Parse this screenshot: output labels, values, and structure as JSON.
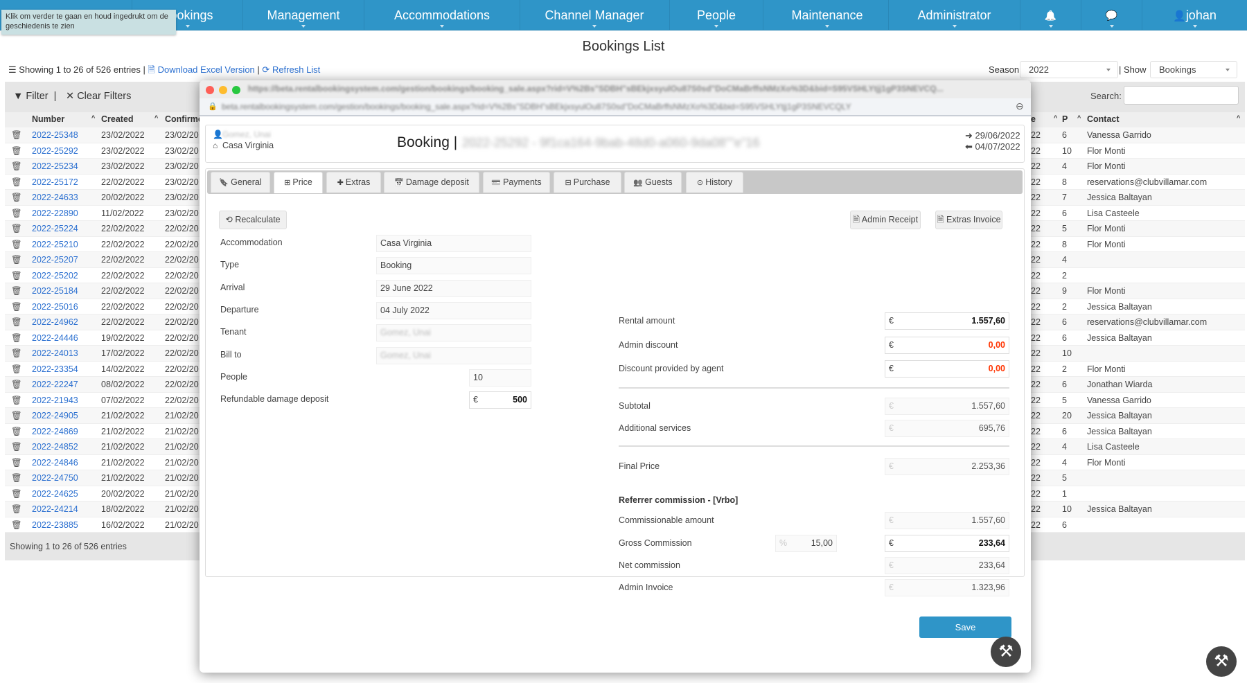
{
  "nav": {
    "items": [
      "Bookings",
      "Management",
      "Accommodations",
      "Channel Manager",
      "People",
      "Maintenance",
      "Administrator"
    ],
    "user": "johan",
    "icons": [
      "bell-icon",
      "chat-icon",
      "user-icon"
    ]
  },
  "tooltip": "Klik om verder te gaan en houd ingedrukt om de geschiedenis te zien",
  "page_title": "Bookings List",
  "toolbar": {
    "showing": "Showing 1 to 26 of 526 entries",
    "download": "Download Excel Version",
    "refresh": "Refresh List",
    "season_label": "Season",
    "season_value": "2022",
    "show_label": "Show",
    "show_value": "Bookings"
  },
  "filter": {
    "filter_label": "Filter",
    "clear_label": "Clear Filters",
    "search_label": "Search:",
    "search_value": ""
  },
  "table": {
    "headers": [
      "Number",
      "Created",
      "Confirme",
      "e",
      "P",
      "Contact"
    ],
    "rows": [
      [
        "2022-25348",
        "23/02/2022",
        "23/02/20",
        "22",
        "6",
        "Vanessa Garrido"
      ],
      [
        "2022-25292",
        "23/02/2022",
        "23/02/20",
        "22",
        "10",
        "Flor Monti"
      ],
      [
        "2022-25234",
        "23/02/2022",
        "23/02/20",
        "22",
        "4",
        "Flor Monti"
      ],
      [
        "2022-25172",
        "22/02/2022",
        "23/02/20",
        "22",
        "8",
        "reservations@clubvillamar.com"
      ],
      [
        "2022-24633",
        "20/02/2022",
        "23/02/20",
        "22",
        "7",
        "Jessica Baltayan"
      ],
      [
        "2022-22890",
        "11/02/2022",
        "23/02/20",
        "22",
        "6",
        "Lisa Casteele"
      ],
      [
        "2022-25224",
        "22/02/2022",
        "22/02/20",
        "22",
        "5",
        "Flor Monti"
      ],
      [
        "2022-25210",
        "22/02/2022",
        "22/02/20",
        "22",
        "8",
        "Flor Monti"
      ],
      [
        "2022-25207",
        "22/02/2022",
        "22/02/20",
        "22",
        "4",
        ""
      ],
      [
        "2022-25202",
        "22/02/2022",
        "22/02/20",
        "22",
        "2",
        ""
      ],
      [
        "2022-25184",
        "22/02/2022",
        "22/02/20",
        "22",
        "9",
        "Flor Monti"
      ],
      [
        "2022-25016",
        "22/02/2022",
        "22/02/20",
        "22",
        "2",
        "Jessica Baltayan"
      ],
      [
        "2022-24962",
        "22/02/2022",
        "22/02/20",
        "22",
        "6",
        "reservations@clubvillamar.com"
      ],
      [
        "2022-24446",
        "19/02/2022",
        "22/02/20",
        "22",
        "6",
        "Jessica Baltayan"
      ],
      [
        "2022-24013",
        "17/02/2022",
        "22/02/20",
        "22",
        "10",
        ""
      ],
      [
        "2022-23354",
        "14/02/2022",
        "22/02/20",
        "22",
        "2",
        "Flor Monti"
      ],
      [
        "2022-22247",
        "08/02/2022",
        "22/02/20",
        "22",
        "6",
        "Jonathan Wiarda"
      ],
      [
        "2022-21943",
        "07/02/2022",
        "22/02/20",
        "22",
        "5",
        "Vanessa Garrido"
      ],
      [
        "2022-24905",
        "21/02/2022",
        "21/02/20",
        "22",
        "20",
        "Jessica Baltayan"
      ],
      [
        "2022-24869",
        "21/02/2022",
        "21/02/20",
        "22",
        "6",
        "Jessica Baltayan"
      ],
      [
        "2022-24852",
        "21/02/2022",
        "21/02/20",
        "22",
        "4",
        "Lisa Casteele"
      ],
      [
        "2022-24846",
        "21/02/2022",
        "21/02/20",
        "22",
        "4",
        "Flor Monti"
      ],
      [
        "2022-24750",
        "21/02/2022",
        "21/02/20",
        "22",
        "5",
        ""
      ],
      [
        "2022-24625",
        "20/02/2022",
        "21/02/20",
        "22",
        "1",
        ""
      ],
      [
        "2022-24214",
        "18/02/2022",
        "21/02/20",
        "22",
        "10",
        "Jessica Baltayan"
      ],
      [
        "2022-23885",
        "16/02/2022",
        "21/02/20",
        "22",
        "6",
        ""
      ]
    ],
    "footer": "Showing 1 to 26 of 526 entries"
  },
  "modal": {
    "url_title": "https://beta.rentalbookingsystem.com/gestion/bookings/booking_sale.aspx?rid=V%2Bs\"SDBH\"sBEkjxsyulOu87S0sd\"DoCMaBrffsNMzXo%3D&bid=S95VSHLYtjj1gP3SNEVCQ...",
    "url": "beta.rentalbookingsystem.com/gestion/bookings/booking_sale.aspx?rid=V%2Bs\"SDBH\"sBEkjxsyulOu87S0sd\"DoCMaBrffsNMzXo%3D&bid=S95VSHLYtjj1gP3SNEVCQLY",
    "tenant_name": "Gomez, Unai",
    "accommodation": "Casa Virginia",
    "booking_title": "Booking |",
    "booking_id": "2022-25292 - 9f1ca164-9bab-48d0-a060-9da08\"\"e\"16",
    "arrival_date": "29/06/2022",
    "departure_date": "04/07/2022",
    "tabs": [
      "General",
      "Price",
      "Extras",
      "Damage deposit",
      "Payments",
      "Purchase",
      "Guests",
      "History"
    ],
    "active_tab": "Price",
    "recalculate": "Recalculate",
    "admin_receipt": "Admin Receipt",
    "extras_invoice": "Extras Invoice",
    "left": {
      "accommodation_label": "Accommodation",
      "accommodation": "Casa Virginia",
      "type_label": "Type",
      "type": "Booking",
      "arrival_label": "Arrival",
      "arrival": "29 June 2022",
      "departure_label": "Departure",
      "departure": "04 July 2022",
      "tenant_label": "Tenant",
      "tenant": "Gomez, Unai",
      "billto_label": "Bill to",
      "billto": "Gomez, Unai",
      "people_label": "People",
      "people": "10",
      "deposit_label": "Refundable damage deposit",
      "deposit": "500"
    },
    "currency": "€",
    "percent": "%",
    "right": {
      "rental_label": "Rental amount",
      "rental": "1.557,60",
      "admin_discount_label": "Admin discount",
      "admin_discount": "0,00",
      "agent_discount_label": "Discount provided by agent",
      "agent_discount": "0,00",
      "subtotal_label": "Subtotal",
      "subtotal": "1.557,60",
      "additional_label": "Additional services",
      "additional": "695,76",
      "final_label": "Final Price",
      "final": "2.253,36",
      "referrer_label": "Referrer commission -  [Vrbo]",
      "commissionable_label": "Commissionable amount",
      "commissionable": "1.557,60",
      "gross_label": "Gross Commission",
      "gross_pct": "15,00",
      "gross": "233,64",
      "net_label": "Net commission",
      "net": "233,64",
      "admin_invoice_label": "Admin Invoice",
      "admin_invoice": "1.323,96"
    },
    "save": "Save"
  },
  "colors": {
    "nav": "#2f95c8",
    "link": "#2a6fd0",
    "discount": "#ff3300",
    "save": "#2f95c8"
  }
}
